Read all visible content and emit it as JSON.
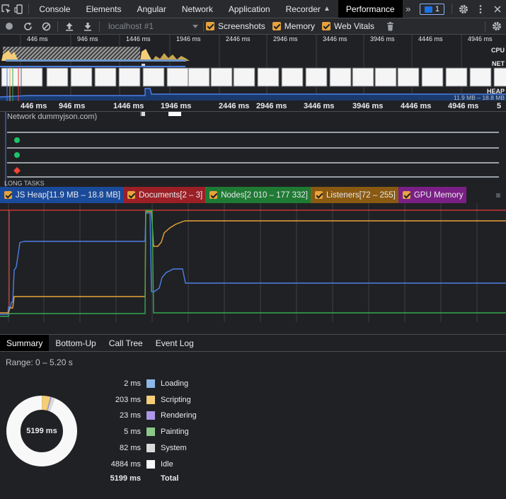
{
  "tabs": [
    "Console",
    "Elements",
    "Angular",
    "Network",
    "Application",
    "Recorder",
    "Performance"
  ],
  "issues_count": "1",
  "toolbar": {
    "target": "localhost #1",
    "checkboxes": [
      "Screenshots",
      "Memory",
      "Web Vitals"
    ]
  },
  "overview": {
    "ticks": [
      "446 ms",
      "946 ms",
      "1446 ms",
      "1946 ms",
      "2446 ms",
      "2946 ms",
      "3446 ms",
      "3946 ms",
      "4446 ms",
      "4946 ms"
    ],
    "labels": {
      "cpu": "CPU",
      "net": "NET",
      "heap": "HEAP",
      "heap_range": "11.9 MB – 18.8 MB"
    }
  },
  "ruler_ticks": [
    "446 ms",
    "946 ms",
    "1446 ms",
    "1946 ms",
    "2446 ms",
    "2946 ms",
    "3446 ms",
    "3946 ms",
    "4446 ms",
    "4946 ms",
    "5"
  ],
  "network_track_label": "Network dummyjson.com)",
  "long_tasks_label": "LONG TASKS",
  "counters": [
    {
      "label": "JS Heap[11.9 MB – 18.8 MB]",
      "bg": "#1a4a9a",
      "color": "#4d7fe8"
    },
    {
      "label": "Documents[2 – 3]",
      "bg": "#9c1f26",
      "color": "#e53935"
    },
    {
      "label": "Nodes[2 010 – 177 332]",
      "bg": "#1f7a34",
      "color": "#34a853"
    },
    {
      "label": "Listeners[72 – 255]",
      "bg": "#8a5a12",
      "color": "#e8a33d"
    },
    {
      "label": "GPU Memory",
      "bg": "#7a1f85",
      "color": "#a142b5"
    }
  ],
  "summary_tabs": [
    "Summary",
    "Bottom-Up",
    "Call Tree",
    "Event Log"
  ],
  "range": "Range: 0 – 5.20 s",
  "breakdown": [
    {
      "value": "2 ms",
      "label": "Loading",
      "color": "#8cb8e8",
      "ms": 2
    },
    {
      "value": "203 ms",
      "label": "Scripting",
      "color": "#f4cd78",
      "ms": 203
    },
    {
      "value": "23 ms",
      "label": "Rendering",
      "color": "#ad97e8",
      "ms": 23
    },
    {
      "value": "5 ms",
      "label": "Painting",
      "color": "#8cc989",
      "ms": 5
    },
    {
      "value": "82 ms",
      "label": "System",
      "color": "#dadada",
      "ms": 82
    },
    {
      "value": "4884 ms",
      "label": "Idle",
      "color": "#f8f8f8",
      "ms": 4884
    }
  ],
  "total": {
    "value": "5199 ms",
    "label": "Total"
  },
  "donut_center": "5199 ms"
}
